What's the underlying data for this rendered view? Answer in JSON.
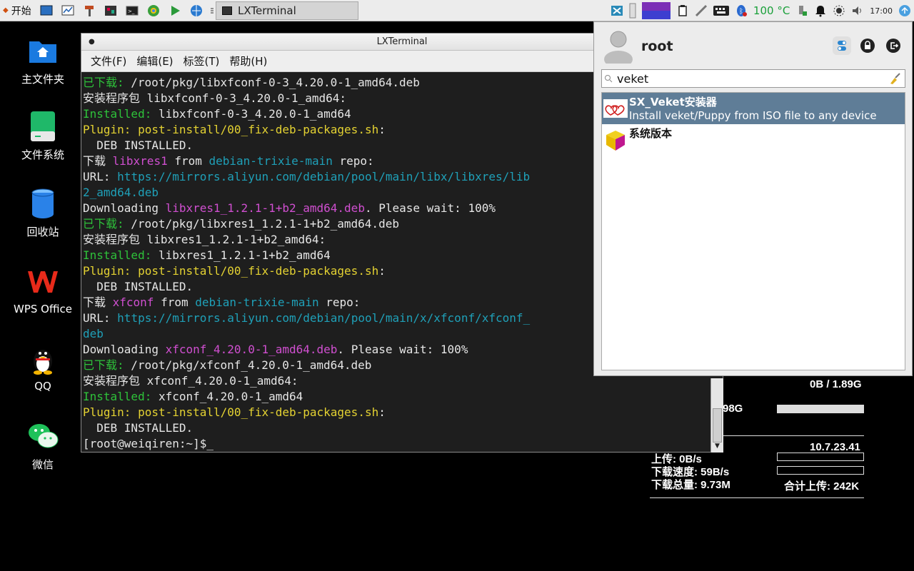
{
  "taskbar": {
    "start_label": "开始",
    "task_title": "LXTerminal",
    "temperature": "100 °C",
    "clock": "17:00"
  },
  "desktop": {
    "icons": [
      {
        "label": "主文件夹"
      },
      {
        "label": "文件系统"
      },
      {
        "label": "回收站"
      },
      {
        "label": "WPS Office"
      },
      {
        "label": "QQ"
      },
      {
        "label": "微信"
      }
    ]
  },
  "terminal": {
    "title": "LXTerminal",
    "menu": [
      "文件(F)",
      "编辑(E)",
      "标签(T)",
      "帮助(H)"
    ],
    "lines": [
      [
        {
          "t": "已下载: ",
          "c": "g"
        },
        {
          "t": "/root/pkg/libxfconf-0-3_4.20.0-1_amd64.deb",
          "c": "w"
        }
      ],
      [
        {
          "t": "安装程序包 libxfconf-0-3_4.20.0-1_amd64:",
          "c": "w"
        }
      ],
      [
        {
          "t": "Installed: ",
          "c": "g"
        },
        {
          "t": "libxfconf-0-3_4.20.0-1_amd64",
          "c": "w"
        }
      ],
      [
        {
          "t": "Plugin: post-install/00_fix-deb-packages.sh",
          "c": "y"
        },
        {
          "t": ":",
          "c": "w"
        }
      ],
      [
        {
          "t": "  DEB INSTALLED.",
          "c": "w"
        }
      ],
      [
        {
          "t": "下载 ",
          "c": "w"
        },
        {
          "t": "libxres1",
          "c": "m"
        },
        {
          "t": " from ",
          "c": "w"
        },
        {
          "t": "debian-trixie-main",
          "c": "c"
        },
        {
          "t": " repo:",
          "c": "w"
        }
      ],
      [
        {
          "t": "URL: ",
          "c": "w"
        },
        {
          "t": "https://mirrors.aliyun.com/debian/pool/main/libx/libxres/lib",
          "c": "c"
        }
      ],
      [
        {
          "t": "2_amd64.deb",
          "c": "c"
        }
      ],
      [
        {
          "t": "Downloading ",
          "c": "w"
        },
        {
          "t": "libxres1_1.2.1-1+b2_amd64.deb",
          "c": "m"
        },
        {
          "t": ". Please wait: 100%",
          "c": "w"
        }
      ],
      [
        {
          "t": "已下载: ",
          "c": "g"
        },
        {
          "t": "/root/pkg/libxres1_1.2.1-1+b2_amd64.deb",
          "c": "w"
        }
      ],
      [
        {
          "t": "安装程序包 libxres1_1.2.1-1+b2_amd64:",
          "c": "w"
        }
      ],
      [
        {
          "t": "Installed: ",
          "c": "g"
        },
        {
          "t": "libxres1_1.2.1-1+b2_amd64",
          "c": "w"
        }
      ],
      [
        {
          "t": "Plugin: post-install/00_fix-deb-packages.sh",
          "c": "y"
        },
        {
          "t": ":",
          "c": "w"
        }
      ],
      [
        {
          "t": "  DEB INSTALLED.",
          "c": "w"
        }
      ],
      [
        {
          "t": "下载 ",
          "c": "w"
        },
        {
          "t": "xfconf",
          "c": "m"
        },
        {
          "t": " from ",
          "c": "w"
        },
        {
          "t": "debian-trixie-main",
          "c": "c"
        },
        {
          "t": " repo:",
          "c": "w"
        }
      ],
      [
        {
          "t": "URL: ",
          "c": "w"
        },
        {
          "t": "https://mirrors.aliyun.com/debian/pool/main/x/xfconf/xfconf_",
          "c": "c"
        }
      ],
      [
        {
          "t": "deb",
          "c": "c"
        }
      ],
      [
        {
          "t": "Downloading ",
          "c": "w"
        },
        {
          "t": "xfconf_4.20.0-1_amd64.deb",
          "c": "m"
        },
        {
          "t": ". Please wait: 100%",
          "c": "w"
        }
      ],
      [
        {
          "t": "已下载: ",
          "c": "g"
        },
        {
          "t": "/root/pkg/xfconf_4.20.0-1_amd64.deb",
          "c": "w"
        }
      ],
      [
        {
          "t": "安装程序包 xfconf_4.20.0-1_amd64:",
          "c": "w"
        }
      ],
      [
        {
          "t": "Installed: ",
          "c": "g"
        },
        {
          "t": "xfconf_4.20.0-1_amd64",
          "c": "w"
        }
      ],
      [
        {
          "t": "Plugin: post-install/00_fix-deb-packages.sh",
          "c": "y"
        },
        {
          "t": ":",
          "c": "w"
        }
      ],
      [
        {
          "t": "  DEB INSTALLED.",
          "c": "w"
        }
      ],
      [
        {
          "t": "[root@weiqiren:~]$_",
          "c": "w"
        }
      ]
    ]
  },
  "menu": {
    "user": "root",
    "search_value": "veket",
    "results": [
      {
        "title": "SX_Veket安装器",
        "desc": "Install veket/Puppy from ISO file to any device",
        "selected": true
      },
      {
        "title": "系统版本",
        "desc": "",
        "selected": false
      }
    ]
  },
  "stats": {
    "mem": "0B / 1.89G",
    "mem_partial": "98G",
    "ip": "10.7.23.41",
    "upload": "上传: 0B/s",
    "download_speed": "下载速度: 59B/s",
    "download_total": "下载总量: 9.73M",
    "upload_total": "合计上传: 242K"
  },
  "colors": {
    "accent_selected": "#5f7d97",
    "term_green": "#2ec23a",
    "term_yellow": "#e4d232",
    "term_magenta": "#d04fd0",
    "term_cyan": "#1fa0b8"
  }
}
